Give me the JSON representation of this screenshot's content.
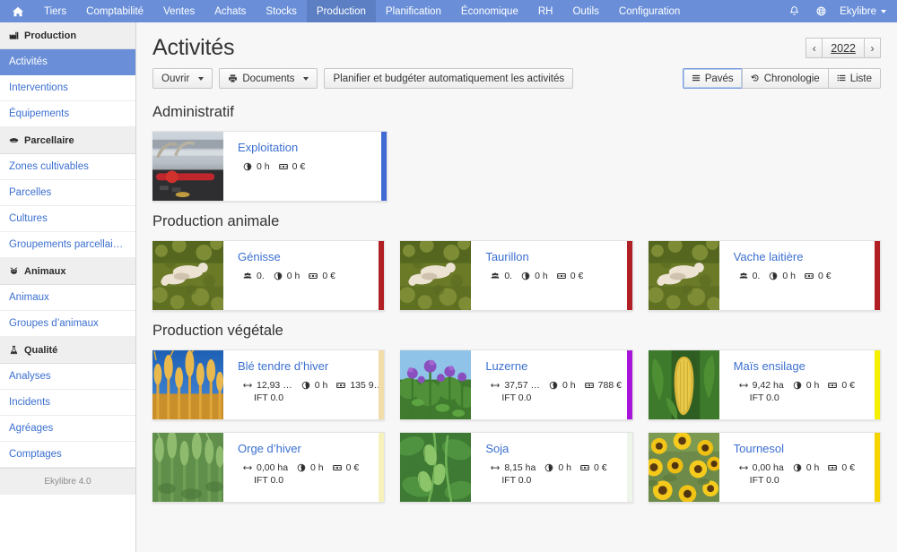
{
  "topnav": {
    "home_icon": "home-icon",
    "items": [
      {
        "label": "Tiers",
        "active": false
      },
      {
        "label": "Comptabilité",
        "active": false
      },
      {
        "label": "Ventes",
        "active": false
      },
      {
        "label": "Achats",
        "active": false
      },
      {
        "label": "Stocks",
        "active": false
      },
      {
        "label": "Production",
        "active": true
      },
      {
        "label": "Planification",
        "active": false
      },
      {
        "label": "Économique",
        "active": false
      },
      {
        "label": "RH",
        "active": false
      },
      {
        "label": "Outils",
        "active": false
      },
      {
        "label": "Configuration",
        "active": false
      }
    ],
    "bell_icon": "bell-icon",
    "globe_icon": "globe-icon",
    "user_label": "Ekylibre"
  },
  "sidebar": {
    "groups": [
      {
        "label": "Production",
        "icon": "factory-icon",
        "links": [
          {
            "label": "Activités",
            "active": true
          },
          {
            "label": "Interventions",
            "active": false
          },
          {
            "label": "Équipements",
            "active": false
          }
        ]
      },
      {
        "label": "Parcellaire",
        "icon": "field-icon",
        "links": [
          {
            "label": "Zones cultivables",
            "active": false
          },
          {
            "label": "Parcelles",
            "active": false
          },
          {
            "label": "Cultures",
            "active": false
          },
          {
            "label": "Groupements parcellaires",
            "active": false
          }
        ]
      },
      {
        "label": "Animaux",
        "icon": "cow-icon",
        "links": [
          {
            "label": "Animaux",
            "active": false
          },
          {
            "label": "Groupes d’animaux",
            "active": false
          }
        ]
      },
      {
        "label": "Qualité",
        "icon": "flask-icon",
        "links": [
          {
            "label": "Analyses",
            "active": false
          },
          {
            "label": "Incidents",
            "active": false
          },
          {
            "label": "Agréages",
            "active": false
          },
          {
            "label": "Comptages",
            "active": false
          }
        ]
      }
    ],
    "footer": "Ekylibre 4.0"
  },
  "page": {
    "title": "Activités",
    "year": "2022",
    "prev_icon": "chevron-left-icon",
    "next_icon": "chevron-right-icon"
  },
  "toolbar": {
    "open_label": "Ouvrir",
    "documents_label": "Documents",
    "documents_icon": "printer-icon",
    "plan_label": "Planifier et budgéter automatiquement les activités",
    "views": [
      {
        "label": "Pavés",
        "icon": "tiles-icon",
        "selected": true
      },
      {
        "label": "Chronologie",
        "icon": "history-icon",
        "selected": false
      },
      {
        "label": "Liste",
        "icon": "list-icon",
        "selected": false
      }
    ]
  },
  "sections": [
    {
      "title": "Administratif",
      "rows": [
        [
          {
            "name": "Exploitation",
            "accent": "#4169d4",
            "thumb": "office-calculator-photo",
            "metrics": [
              {
                "icon": "clock-icon",
                "value": "0 h"
              },
              {
                "icon": "money-icon",
                "value": "0 €"
              }
            ],
            "ift": null
          }
        ]
      ]
    },
    {
      "title": "Production animale",
      "rows": [
        [
          {
            "name": "Génisse",
            "accent": "#b01f24",
            "thumb": "cattle-pasture-photo",
            "metrics": [
              {
                "icon": "group-icon",
                "value": "0."
              },
              {
                "icon": "clock-icon",
                "value": "0 h"
              },
              {
                "icon": "money-icon",
                "value": "0 €"
              }
            ],
            "ift": null
          },
          {
            "name": "Taurillon",
            "accent": "#b01f24",
            "thumb": "cattle-pasture-photo",
            "metrics": [
              {
                "icon": "group-icon",
                "value": "0."
              },
              {
                "icon": "clock-icon",
                "value": "0 h"
              },
              {
                "icon": "money-icon",
                "value": "0 €"
              }
            ],
            "ift": null
          },
          {
            "name": "Vache laitière",
            "accent": "#b01f24",
            "thumb": "cattle-pasture-photo",
            "metrics": [
              {
                "icon": "group-icon",
                "value": "0."
              },
              {
                "icon": "clock-icon",
                "value": "0 h"
              },
              {
                "icon": "money-icon",
                "value": "0 €"
              }
            ],
            "ift": null
          }
        ]
      ]
    },
    {
      "title": "Production végétale",
      "rows": [
        [
          {
            "name": "Blé tendre d’hiver",
            "accent": "#f2ddaa",
            "thumb": "wheat-photo",
            "metrics": [
              {
                "icon": "area-icon",
                "value": "12,93 …"
              },
              {
                "icon": "clock-icon",
                "value": "0 h"
              },
              {
                "icon": "money-icon",
                "value": "135 9…"
              }
            ],
            "ift": "IFT 0.0"
          },
          {
            "name": "Luzerne",
            "accent": "#a715d8",
            "thumb": "alfalfa-photo",
            "metrics": [
              {
                "icon": "area-icon",
                "value": "37,57 …"
              },
              {
                "icon": "clock-icon",
                "value": "0 h"
              },
              {
                "icon": "money-icon",
                "value": "788 €"
              }
            ],
            "ift": "IFT 0.0"
          },
          {
            "name": "Maïs ensilage",
            "accent": "#f5f000",
            "thumb": "maize-photo",
            "metrics": [
              {
                "icon": "area-icon",
                "value": "9,42 ha"
              },
              {
                "icon": "clock-icon",
                "value": "0 h"
              },
              {
                "icon": "money-icon",
                "value": "0 €"
              }
            ],
            "ift": "IFT 0.0"
          }
        ],
        [
          {
            "name": "Orge d’hiver",
            "accent": "#f7f2bb",
            "thumb": "barley-photo",
            "metrics": [
              {
                "icon": "area-icon",
                "value": "0,00 ha"
              },
              {
                "icon": "clock-icon",
                "value": "0 h"
              },
              {
                "icon": "money-icon",
                "value": "0 €"
              }
            ],
            "ift": "IFT 0.0"
          },
          {
            "name": "Soja",
            "accent": "#eef6ec",
            "thumb": "soy-photo",
            "metrics": [
              {
                "icon": "area-icon",
                "value": "8,15 ha"
              },
              {
                "icon": "clock-icon",
                "value": "0 h"
              },
              {
                "icon": "money-icon",
                "value": "0 €"
              }
            ],
            "ift": "IFT 0.0"
          },
          {
            "name": "Tournesol",
            "accent": "#f5d400",
            "thumb": "sunflower-photo",
            "metrics": [
              {
                "icon": "area-icon",
                "value": "0,00 ha"
              },
              {
                "icon": "clock-icon",
                "value": "0 h"
              },
              {
                "icon": "money-icon",
                "value": "0 €"
              }
            ],
            "ift": "IFT 0.0"
          }
        ]
      ]
    }
  ]
}
